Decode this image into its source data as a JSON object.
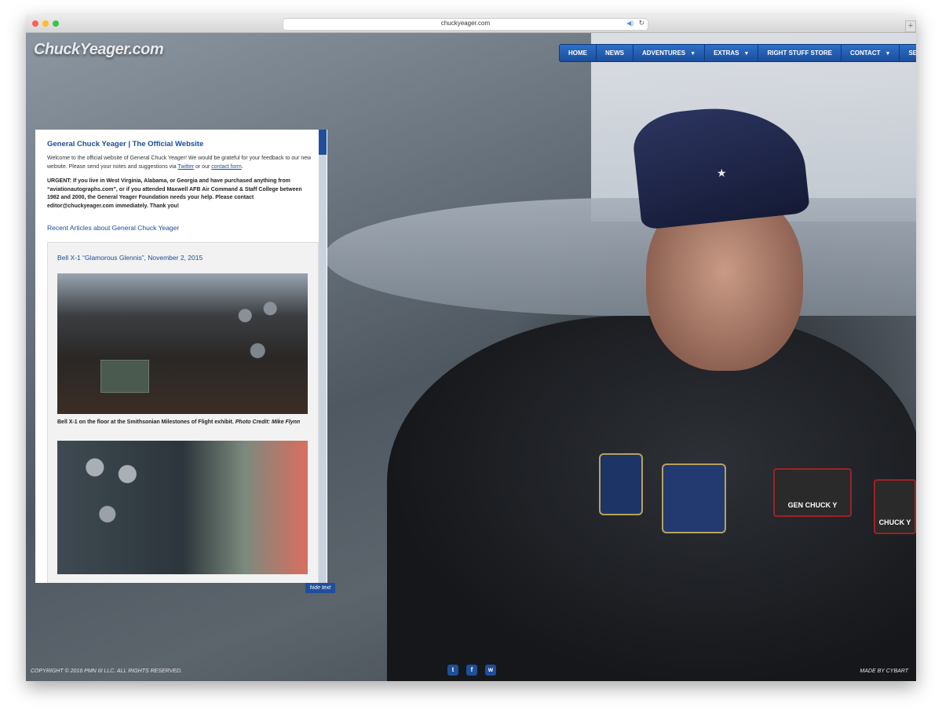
{
  "browser": {
    "url": "chuckyeager.com"
  },
  "header": {
    "logo": "ChuckYeager.com",
    "nav": [
      {
        "label": "HOME",
        "dropdown": false
      },
      {
        "label": "NEWS",
        "dropdown": false
      },
      {
        "label": "ADVENTURES",
        "dropdown": true
      },
      {
        "label": "EXTRAS",
        "dropdown": true
      },
      {
        "label": "RIGHT STUFF STORE",
        "dropdown": false
      },
      {
        "label": "CONTACT",
        "dropdown": true
      },
      {
        "label": "SEARCH",
        "dropdown": true
      }
    ]
  },
  "hero": {
    "cap_star": "★",
    "name_patch": "GEN CHUCK Y",
    "name_patch_2": "CHUCK Y"
  },
  "panel": {
    "title": "General Chuck Yeager | The Official Website",
    "welcome_text": "Welcome to the official website of General Chuck Yeager! We would be grateful for your feedback to our new website. Please send your notes and suggestions via",
    "twitter_link": "Twitter",
    "or_text": "or our",
    "contact_link": "contact form",
    "period": ".",
    "urgent": "URGENT: If you live in West Virginia, Alabama, or Georgia and have purchased anything from “aviationautographs.com”, or if you attended Maxwell AFB Air Command & Staff College between 1982 and 2000, the General Yeager Foundation needs your help.  Please contact editor@chuckyeager.com immediately.  Thank you!",
    "recent_heading": "Recent Articles about General Chuck Yeager",
    "article": {
      "title": "Bell X-1 “Glamorous Glennis”, November 2, 2015",
      "caption": "Bell X-1 on the floor at the Smithsonian Milestones of Flight exhibit.",
      "photo_credit": "Photo Credit: Mike Flynn"
    },
    "hide_text": "hide text"
  },
  "footer": {
    "copyright": "COPYRIGHT © 2016 PMN III LLC. ALL RIGHTS RESERVED.",
    "made_by": "MADE BY CYBART",
    "social": [
      "t",
      "f",
      "w"
    ]
  },
  "colors": {
    "accent": "#1f4e9a",
    "link": "#1a4c96"
  }
}
